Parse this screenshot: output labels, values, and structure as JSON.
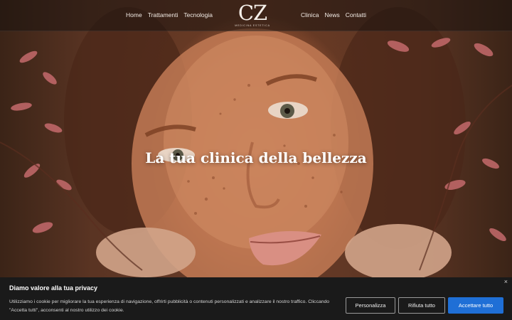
{
  "header": {
    "nav_left": [
      "Home",
      "Trattamenti",
      "Tecnologia"
    ],
    "nav_right": [
      "Clinica",
      "News",
      "Contatti"
    ],
    "logo_mark": "CZ",
    "logo_sub": "Medicina Estetica"
  },
  "hero": {
    "headline": "La tua clinica della bellezza"
  },
  "cookie": {
    "close": "×",
    "title": "Diamo valore alla tua privacy",
    "text": "Utilizziamo i cookie per migliorare la tua esperienza di navigazione, offrirti pubblicità o contenuti personalizzati e analizzare il nostro traffico. Cliccando \"Accetta tutti\", acconsenti al nostro utilizzo dei cookie.",
    "customize": "Personalizza",
    "reject": "Rifiuta tutto",
    "accept": "Accettare tutto"
  },
  "colors": {
    "accent": "#1f6fd6",
    "banner_bg": "#1a1a1a"
  }
}
